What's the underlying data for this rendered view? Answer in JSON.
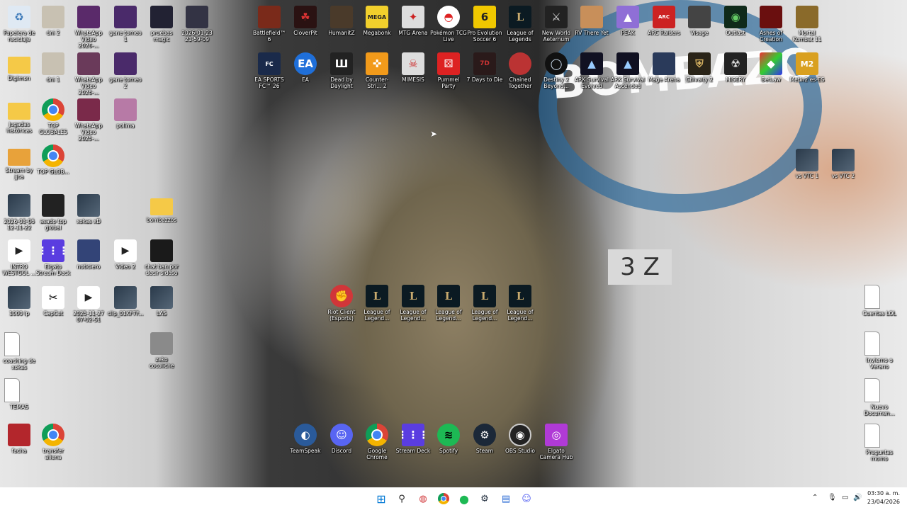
{
  "desktop": {
    "col1": [
      "Papelera de reciclaje",
      "Digimon",
      "jugadas históricas",
      "Stream by jjca",
      "2026-03-06 12-11-22",
      "INTRO WESTGOL ...",
      "1000 lp",
      "coaching de xokas",
      "TEMAS",
      "facha"
    ],
    "col2": [
      "dni 2",
      "dni 1",
      "TOP GLOBALES",
      "TOP GLOB...",
      "asado top global",
      "Elgato Stream Deck",
      "CapCut",
      "transfer aliena"
    ],
    "col3": [
      "WhatsApp Video 2026-...",
      "WhatsApp Video 2026-...",
      "WhatsApp Video 2025-...",
      "xokas xD",
      "noticiero",
      "2025-11-27 07-02-51"
    ],
    "col4": [
      "gane torneo 1",
      "gane torneo 2",
      "polima",
      "Video 2",
      "clip_01KF7F..."
    ],
    "col5": [
      "pruebas magic",
      "bombazzos",
      "chat ban por decir sidoso",
      "LAS",
      "zeko cocoliche"
    ],
    "col6": [
      "2026-01-23 21-59-09"
    ],
    "games_row1": [
      "Battlefield™ 6",
      "CloverPit",
      "HumanitZ",
      "Megabonk",
      "MTG Arena",
      "Pokémon TCG Live",
      "Pro Evolution Soccer 6",
      "League of Legends",
      "New World Aeternum",
      "RV There Yet",
      "PEAK",
      "ARC Raiders",
      "Visage",
      "Outlast",
      "Ashes of Creation",
      "Mortal Kombat 11"
    ],
    "games_row2": [
      "EA SPORTS FC™ 26",
      "EA",
      "Dead by Daylight",
      "Counter-Stri... 2",
      "MIMESIS",
      "Pummel Party",
      "7 Days to Die",
      "Chained Together",
      "Destiny 2 Beyond...",
      "ARK Survival Evolved",
      "ARK Survival Ascended",
      "Mage Arena",
      "Chivalry 2",
      "MISERY",
      "BetLaw",
      "Metin2 es-ES"
    ],
    "right_side": [
      "vs VTC 1",
      "vs VTC 2"
    ],
    "right_docs": [
      "Cuentas LOL",
      "Invierno o Verano",
      "Nuevo Documen...",
      "Preguntas momo"
    ],
    "center_row": [
      "Riot Client (Esports)",
      "League of Legend...",
      "League of Legend...",
      "League of Legend...",
      "League of Legend...",
      "League of Legend..."
    ],
    "dock_row": [
      "TeamSpeak",
      "Discord",
      "Google Chrome",
      "Stream Deck",
      "Spotify",
      "Steam",
      "OBS Studio",
      "Elgato Camera Hub"
    ]
  },
  "wallpaper": {
    "caption": "BOMBAZO",
    "box_text": "3 Z"
  },
  "taskbar": {
    "apps": [
      "start-icon",
      "search-icon",
      "riot-icon",
      "chrome-icon",
      "spotify-icon",
      "steam-icon",
      "notepad-icon",
      "discord-icon"
    ],
    "time": "03:30 a. m.",
    "date": "23/04/2026"
  },
  "colors": {
    "taskbar_bg": "#ffffff",
    "text_shadow": "#000000",
    "spotify": "#1db954",
    "discord": "#5865f2"
  }
}
